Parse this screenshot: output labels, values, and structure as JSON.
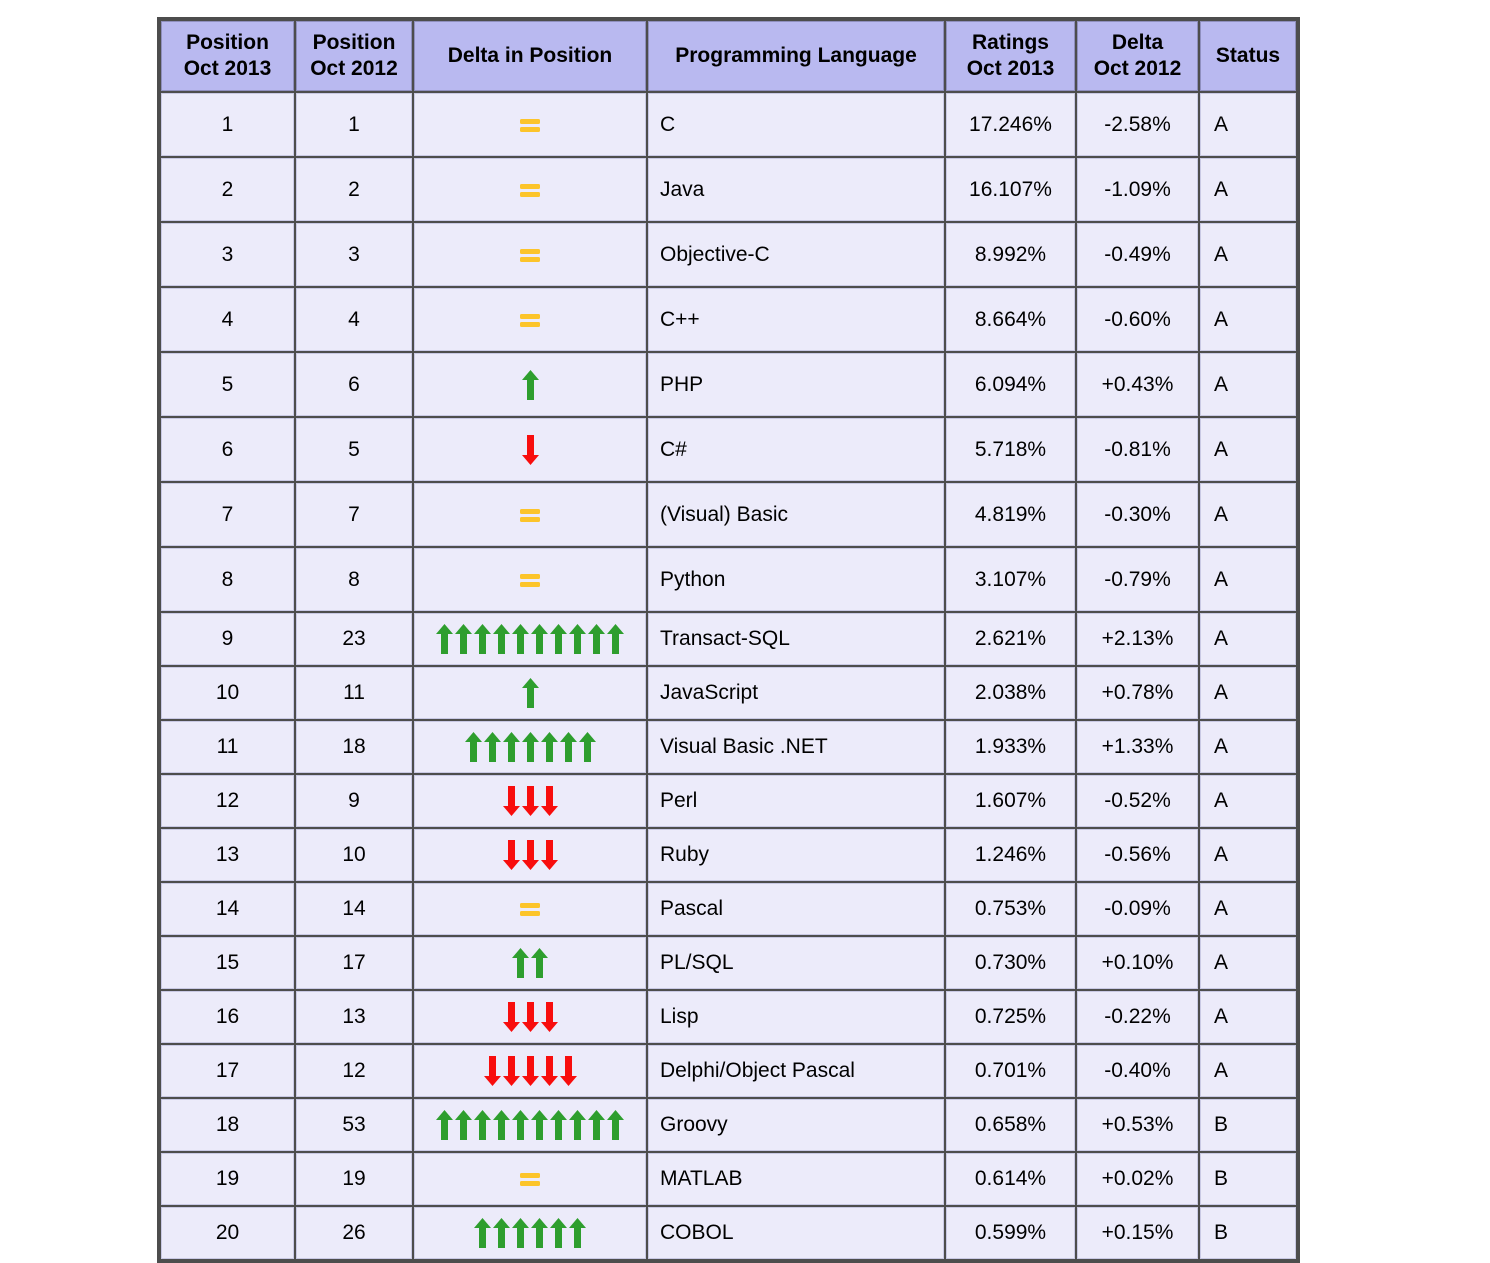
{
  "table": {
    "headers": [
      "Position\nOct 2013",
      "Position\nOct 2012",
      "Delta in Position",
      "Programming Language",
      "Ratings\nOct 2013",
      "Delta\nOct 2012",
      "Status"
    ],
    "headers_flat": {
      "position_2013": "Position Oct 2013",
      "position_2012": "Position Oct 2012",
      "delta_in_position": "Delta in Position",
      "programming_language": "Programming Language",
      "ratings_2013": "Ratings Oct 2013",
      "delta_2012": "Delta Oct 2012",
      "status": "Status"
    },
    "colors": {
      "header_background": "#b9b9f0",
      "cell_background": "#ecebfa",
      "grid": "#4d4d4d",
      "language_text": "#1b1bb3",
      "arrow_up": "#2e9e2e",
      "arrow_down": "#f80d0d",
      "equal_sign": "#fcc42a"
    },
    "rows": [
      {
        "position_2013": "1",
        "position_2012": "1",
        "delta_direction": "equal",
        "delta_count": 1,
        "language": "C",
        "ratings": "17.246%",
        "delta": "-2.58%",
        "status": "A"
      },
      {
        "position_2013": "2",
        "position_2012": "2",
        "delta_direction": "equal",
        "delta_count": 1,
        "language": "Java",
        "ratings": "16.107%",
        "delta": "-1.09%",
        "status": "A"
      },
      {
        "position_2013": "3",
        "position_2012": "3",
        "delta_direction": "equal",
        "delta_count": 1,
        "language": "Objective-C",
        "ratings": "8.992%",
        "delta": "-0.49%",
        "status": "A"
      },
      {
        "position_2013": "4",
        "position_2012": "4",
        "delta_direction": "equal",
        "delta_count": 1,
        "language": "C++",
        "ratings": "8.664%",
        "delta": "-0.60%",
        "status": "A"
      },
      {
        "position_2013": "5",
        "position_2012": "6",
        "delta_direction": "up",
        "delta_count": 1,
        "language": "PHP",
        "ratings": "6.094%",
        "delta": "+0.43%",
        "status": "A"
      },
      {
        "position_2013": "6",
        "position_2012": "5",
        "delta_direction": "down",
        "delta_count": 1,
        "language": "C#",
        "ratings": "5.718%",
        "delta": "-0.81%",
        "status": "A"
      },
      {
        "position_2013": "7",
        "position_2012": "7",
        "delta_direction": "equal",
        "delta_count": 1,
        "language": "(Visual) Basic",
        "ratings": "4.819%",
        "delta": "-0.30%",
        "status": "A"
      },
      {
        "position_2013": "8",
        "position_2012": "8",
        "delta_direction": "equal",
        "delta_count": 1,
        "language": "Python",
        "ratings": "3.107%",
        "delta": "-0.79%",
        "status": "A"
      },
      {
        "position_2013": "9",
        "position_2012": "23",
        "delta_direction": "up",
        "delta_count": 10,
        "language": "Transact-SQL",
        "ratings": "2.621%",
        "delta": "+2.13%",
        "status": "A"
      },
      {
        "position_2013": "10",
        "position_2012": "11",
        "delta_direction": "up",
        "delta_count": 1,
        "language": "JavaScript",
        "ratings": "2.038%",
        "delta": "+0.78%",
        "status": "A"
      },
      {
        "position_2013": "11",
        "position_2012": "18",
        "delta_direction": "up",
        "delta_count": 7,
        "language": "Visual Basic .NET",
        "ratings": "1.933%",
        "delta": "+1.33%",
        "status": "A"
      },
      {
        "position_2013": "12",
        "position_2012": "9",
        "delta_direction": "down",
        "delta_count": 3,
        "language": "Perl",
        "ratings": "1.607%",
        "delta": "-0.52%",
        "status": "A"
      },
      {
        "position_2013": "13",
        "position_2012": "10",
        "delta_direction": "down",
        "delta_count": 3,
        "language": "Ruby",
        "ratings": "1.246%",
        "delta": "-0.56%",
        "status": "A"
      },
      {
        "position_2013": "14",
        "position_2012": "14",
        "delta_direction": "equal",
        "delta_count": 1,
        "language": "Pascal",
        "ratings": "0.753%",
        "delta": "-0.09%",
        "status": "A"
      },
      {
        "position_2013": "15",
        "position_2012": "17",
        "delta_direction": "up",
        "delta_count": 2,
        "language": "PL/SQL",
        "ratings": "0.730%",
        "delta": "+0.10%",
        "status": "A"
      },
      {
        "position_2013": "16",
        "position_2012": "13",
        "delta_direction": "down",
        "delta_count": 3,
        "language": "Lisp",
        "ratings": "0.725%",
        "delta": "-0.22%",
        "status": "A"
      },
      {
        "position_2013": "17",
        "position_2012": "12",
        "delta_direction": "down",
        "delta_count": 5,
        "language": "Delphi/Object Pascal",
        "ratings": "0.701%",
        "delta": "-0.40%",
        "status": "A"
      },
      {
        "position_2013": "18",
        "position_2012": "53",
        "delta_direction": "up",
        "delta_count": 10,
        "language": "Groovy",
        "ratings": "0.658%",
        "delta": "+0.53%",
        "status": "B"
      },
      {
        "position_2013": "19",
        "position_2012": "19",
        "delta_direction": "equal",
        "delta_count": 1,
        "language": "MATLAB",
        "ratings": "0.614%",
        "delta": "+0.02%",
        "status": "B"
      },
      {
        "position_2013": "20",
        "position_2012": "26",
        "delta_direction": "up",
        "delta_count": 6,
        "language": "COBOL",
        "ratings": "0.599%",
        "delta": "+0.15%",
        "status": "B"
      }
    ]
  }
}
